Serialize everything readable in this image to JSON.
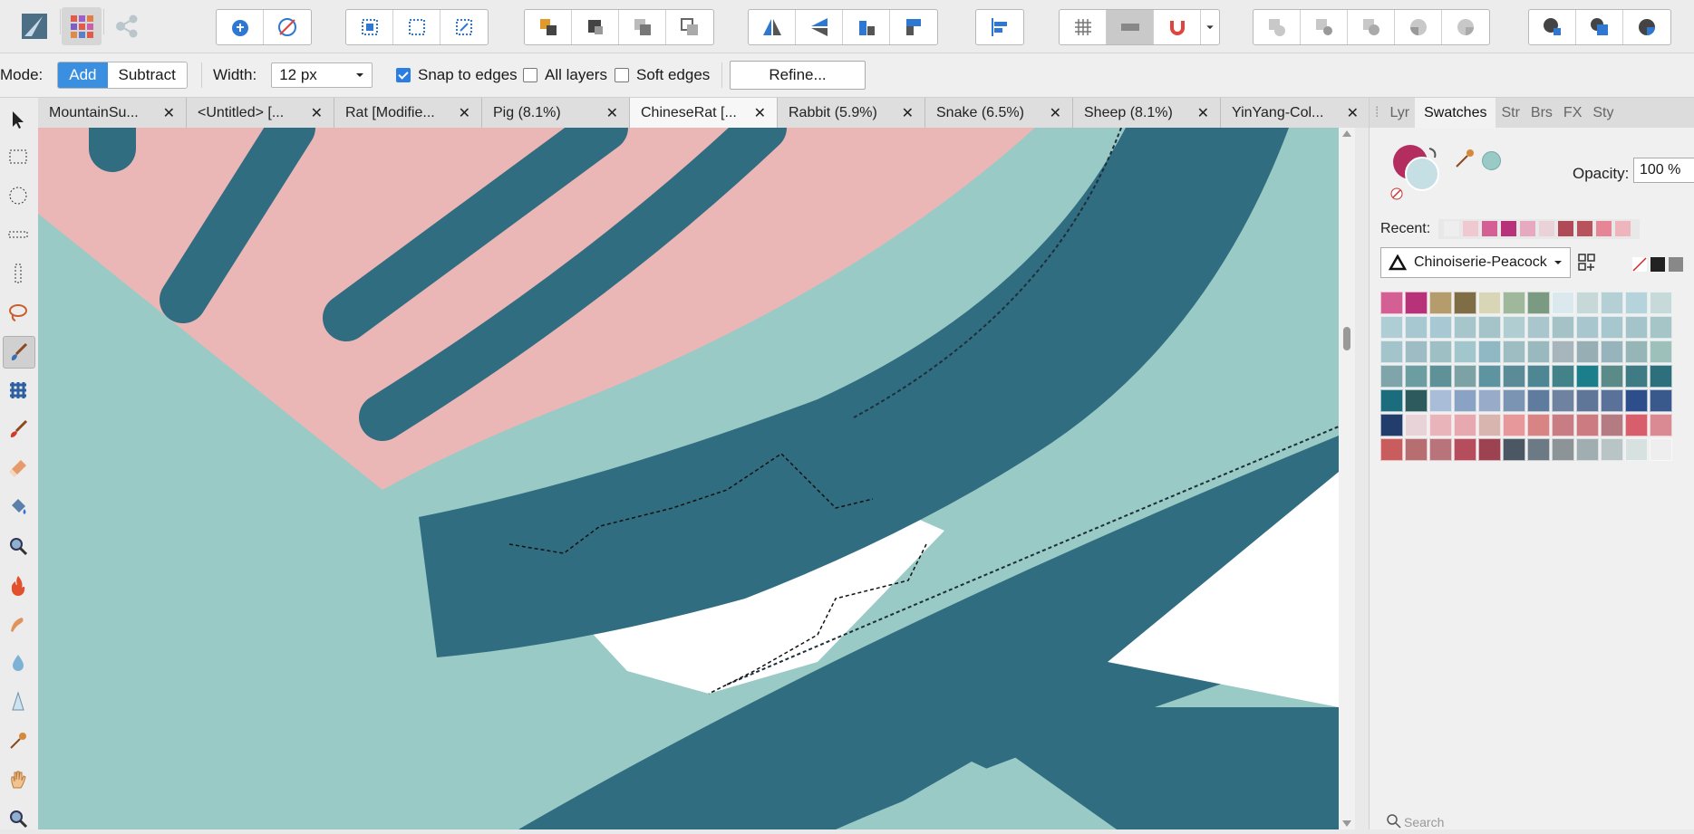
{
  "toolbar": {
    "personas": [
      "designer-persona-icon",
      "pixel-persona-icon",
      "export-persona-icon"
    ],
    "groups": [
      {
        "name": "selection-tools",
        "icons": [
          "quick-select-icon",
          "flood-select-icon"
        ]
      },
      {
        "name": "grid-tools",
        "icons": [
          "select-all-icon",
          "deselect-icon",
          "invert-selection-icon"
        ]
      },
      {
        "name": "arrange-tools",
        "icons": [
          "move-to-front-icon",
          "move-forward-icon",
          "move-backward-icon",
          "move-to-back-icon"
        ]
      },
      {
        "name": "transform-tools",
        "icons": [
          "flip-horizontal-icon",
          "flip-vertical-icon",
          "rotate-left-icon",
          "rotate-right-icon"
        ]
      },
      {
        "name": "align-tools",
        "icons": [
          "align-left-icon"
        ]
      },
      {
        "name": "snapping-tools",
        "icons": [
          "grid-icon",
          "snap-toggle-icon",
          "magnet-icon",
          "dropdown-arrow-icon"
        ]
      },
      {
        "name": "boolean-tools",
        "icons": [
          "add-icon",
          "subtract-icon",
          "intersect-icon",
          "xor-icon",
          "divide-icon"
        ]
      },
      {
        "name": "geometry-tools",
        "icons": [
          "combine-icon",
          "front-icon",
          "pie-icon"
        ]
      }
    ]
  },
  "context": {
    "mode_label": "Mode:",
    "mode_options": [
      "Add",
      "Subtract"
    ],
    "mode_selected": "Add",
    "width_label": "Width:",
    "width_value": "12 px",
    "snap_to_edges": {
      "label": "Snap to edges",
      "checked": true
    },
    "all_layers": {
      "label": "All layers",
      "checked": false
    },
    "soft_edges": {
      "label": "Soft edges",
      "checked": false
    },
    "refine_label": "Refine..."
  },
  "tools": [
    "move-tool-icon",
    "rectangular-marquee-icon",
    "elliptical-marquee-icon",
    "row-marquee-icon",
    "column-marquee-icon",
    "freehand-selection-icon",
    "selection-brush-icon",
    "flood-select-icon",
    "paint-brush-icon",
    "erase-brush-icon",
    "flood-fill-icon",
    "zoom-tool-icon",
    "burn-brush-icon",
    "dodge-brush-icon",
    "blur-brush-icon",
    "sharpen-brush-icon",
    "color-picker-icon",
    "view-tool-icon",
    "zoom-tool-icon"
  ],
  "tabs": [
    {
      "label": "MountainSu...",
      "active": false
    },
    {
      "label": "<Untitled> [...",
      "active": false
    },
    {
      "label": "Rat [Modifie...",
      "active": false
    },
    {
      "label": "Pig (8.1%)",
      "active": false
    },
    {
      "label": "ChineseRat [...",
      "active": true
    },
    {
      "label": "Rabbit (5.9%)",
      "active": false
    },
    {
      "label": "Snake (6.5%)",
      "active": false
    },
    {
      "label": "Sheep (8.1%)",
      "active": false
    },
    {
      "label": "YinYang-Col...",
      "active": false
    }
  ],
  "panel": {
    "tabs": [
      "Lyr",
      "Swatches",
      "Str",
      "Brs",
      "FX",
      "Sty"
    ],
    "active_tab": "Swatches",
    "opacity_label": "Opacity:",
    "opacity_value": "100 %",
    "recent_label": "Recent:",
    "palette_name": "Chinoiserie-Peacock",
    "search_placeholder": "Search",
    "fill_color": "#b32e5f",
    "stroke_color": "#c5dfe4",
    "picked_color": "#99cac5",
    "recent_colors": [
      "#eeeeee",
      "#f0c8cf",
      "#d45f94",
      "#b8327a",
      "#e6a9bf",
      "#e9d3d8",
      "#b14a57",
      "#b8535e",
      "#e58596",
      "#efb5bd"
    ],
    "swatch_rows": [
      [
        "#d45f94",
        "#b8327a",
        "#b49c6c",
        "#7f6e45",
        "#d9d6b8",
        "#9fb79a",
        "#7a9a82",
        "#dbe9ee",
        "#c6d8d8",
        "#b5d0d5",
        "#b5d3da",
        "#c6dada"
      ],
      [
        "#aecdd5",
        "#a7c8d0",
        "#a8c9d3",
        "#a6c6cc",
        "#a4c4ca",
        "#b0cdd2",
        "#a9c6cd",
        "#a5c3c7",
        "#a7c6cd",
        "#a7c7ce",
        "#a5c4ca",
        "#a5c5c7"
      ],
      [
        "#a2c4ca",
        "#9dbcc4",
        "#9ec0c5",
        "#a1c6cc",
        "#8fb8c4",
        "#9ebdc2",
        "#99b9bf",
        "#a7b5bc",
        "#98aeb5",
        "#97b4bc",
        "#95b5b7",
        "#9dc0bb"
      ],
      [
        "#7fa5aa",
        "#6c9da1",
        "#5f9198",
        "#7ca2a5",
        "#5e93a0",
        "#5a8b97",
        "#4e8694",
        "#44828a",
        "#1c7e8a",
        "#5a8b88",
        "#3e7b84",
        "#2e6f7e"
      ],
      [
        "#1b6c7c",
        "#2c5a5d",
        "#a9bcd8",
        "#8aa2c4",
        "#98acca",
        "#7b94b4",
        "#5f7b9d",
        "#6f82a0",
        "#5f7699",
        "#5a7299",
        "#2d4e8b",
        "#39588c"
      ],
      [
        "#223d6b",
        "#e8d4d8",
        "#e9b5bb",
        "#e7a8af",
        "#d9b5b0",
        "#e7989a",
        "#d98484",
        "#c87c84",
        "#cc7b80",
        "#b57b82",
        "#d75e6a",
        "#d98a92"
      ],
      [
        "#c95c5d",
        "#b76e70",
        "#b8747a",
        "#b64d5c",
        "#9c4250",
        "#4b5763",
        "#6b7a84",
        "#8d9497",
        "#a0aeb2",
        "#b9c4c6",
        "#d6e1e0",
        "#eeeeee"
      ]
    ]
  }
}
